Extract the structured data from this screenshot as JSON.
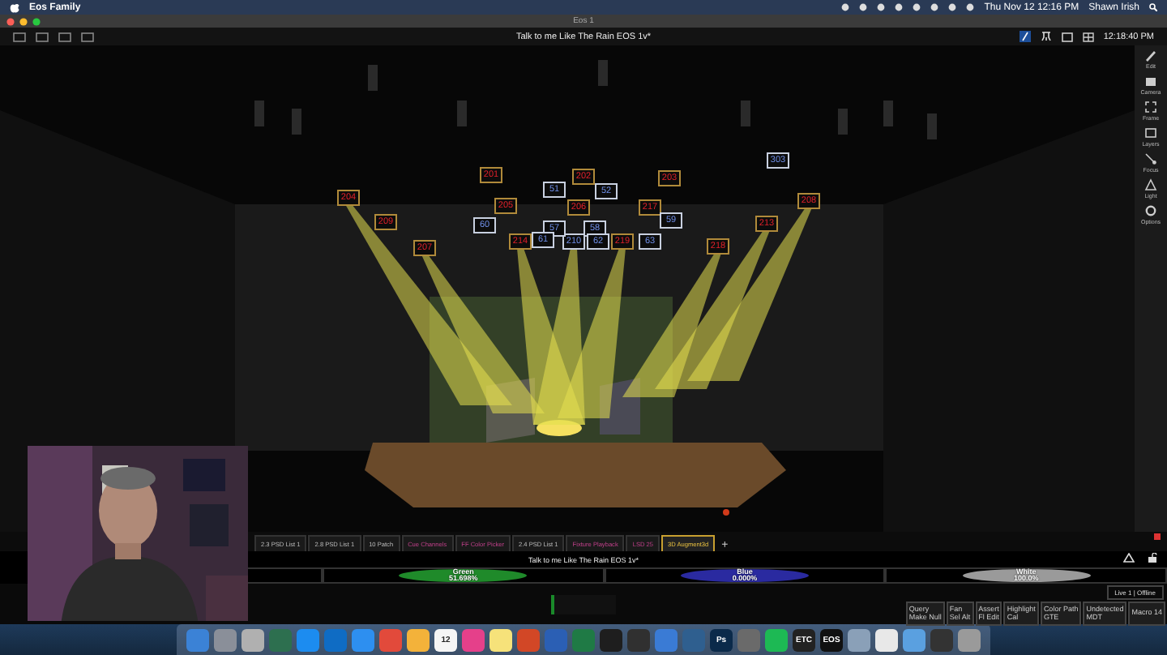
{
  "menu_bar": {
    "app": "Eos Family",
    "clock": "Thu Nov 12 12:16 PM",
    "user": "Shawn Irish"
  },
  "window": {
    "title": "Eos 1"
  },
  "toolbar": {
    "title": "Talk to me Like The Rain EOS 1v*",
    "clock": "12:18:40 PM"
  },
  "fixtures": [
    {
      "label": "204",
      "kind": "conventional"
    },
    {
      "label": "209",
      "kind": "conventional"
    },
    {
      "label": "207",
      "kind": "conventional"
    },
    {
      "label": "201",
      "kind": "conventional"
    },
    {
      "label": "205",
      "kind": "conventional"
    },
    {
      "label": "214",
      "kind": "conventional"
    },
    {
      "label": "202",
      "kind": "conventional"
    },
    {
      "label": "206",
      "kind": "conventional"
    },
    {
      "label": "210",
      "kind": "led"
    },
    {
      "label": "219",
      "kind": "conventional"
    },
    {
      "label": "203",
      "kind": "conventional"
    },
    {
      "label": "217",
      "kind": "conventional"
    },
    {
      "label": "213",
      "kind": "conventional"
    },
    {
      "label": "208",
      "kind": "conventional"
    },
    {
      "label": "218",
      "kind": "conventional"
    },
    {
      "label": "303",
      "kind": "led"
    },
    {
      "label": "51",
      "kind": "led"
    },
    {
      "label": "52",
      "kind": "led"
    },
    {
      "label": "60",
      "kind": "led"
    },
    {
      "label": "57",
      "kind": "led"
    },
    {
      "label": "58",
      "kind": "led"
    },
    {
      "label": "59",
      "kind": "led"
    },
    {
      "label": "61",
      "kind": "led"
    },
    {
      "label": "62",
      "kind": "led"
    },
    {
      "label": "63",
      "kind": "led"
    }
  ],
  "side_tools": [
    "Edit",
    "Camera",
    "Frame",
    "Layers",
    "Focus",
    "Light",
    "Options"
  ],
  "tabs": [
    {
      "label": "2.3 PSD List 1",
      "selected": false,
      "kind": "plain"
    },
    {
      "label": "2.8 PSD List 1",
      "selected": false,
      "kind": "plain"
    },
    {
      "label": "10 Patch",
      "selected": false,
      "kind": "plain"
    },
    {
      "label": "Cue Channels",
      "selected": false,
      "kind": "pink"
    },
    {
      "label": "FF Color Picker",
      "selected": false,
      "kind": "pink"
    },
    {
      "label": "2.4 PSD List 1",
      "selected": false,
      "kind": "plain"
    },
    {
      "label": "Fixture Playback",
      "selected": false,
      "kind": "pink"
    },
    {
      "label": "LSD 25",
      "selected": false,
      "kind": "pink"
    },
    {
      "label": "3D Augment3d",
      "selected": true,
      "kind": "plain"
    }
  ],
  "add_tab": "+",
  "cue_line": {
    "title": "Talk to me Like The Rain EOS 1v*"
  },
  "color_bars": [
    {
      "name": "Green",
      "reading": "51.698%",
      "color": "#1f8a2a"
    },
    {
      "name": "Blue",
      "reading": "0.000%",
      "color": "#2a2aa0"
    },
    {
      "name": "White",
      "reading": "100.0%",
      "color": "#9a9a9a"
    }
  ],
  "status": "Live 1 | Offline",
  "softkeys": [
    {
      "label": "Query",
      "value": "Make Null"
    },
    {
      "label": "Fan",
      "value": "Sel Alt"
    },
    {
      "label": "Assert",
      "value": "Fl Edit"
    },
    {
      "label": "Highlight",
      "value": "Cal"
    },
    {
      "label": "Color Path",
      "value": "GTE"
    },
    {
      "label": "Undetected",
      "value": "MDT"
    },
    {
      "value": "Macro 14"
    }
  ],
  "dock": [
    {
      "color": "#3b82d6"
    },
    {
      "color": "#8a8f99"
    },
    {
      "color": "#b0b0b0"
    },
    {
      "color": "#2d6f4f"
    },
    {
      "color": "#1c8cf0"
    },
    {
      "color": "#0f6cc4"
    },
    {
      "color": "#2d8ff0"
    },
    {
      "color": "#e24a3b"
    },
    {
      "color": "#f3b23a"
    },
    {
      "color": "#f5f5f5",
      "label": "12"
    },
    {
      "color": "#e5408a"
    },
    {
      "color": "#f6e27a"
    },
    {
      "color": "#d24726"
    },
    {
      "color": "#2b5fb4"
    },
    {
      "color": "#1f7a45"
    },
    {
      "color": "#1e1e1e"
    },
    {
      "color": "#303030"
    },
    {
      "color": "#3a7bd5"
    },
    {
      "color": "#2f5f8f"
    },
    {
      "color": "#0b2a4a",
      "label": "Ps"
    },
    {
      "color": "#6a6a6a"
    },
    {
      "color": "#1db954"
    },
    {
      "color": "#222222",
      "label": "ETC"
    },
    {
      "color": "#111111",
      "label": "EOS"
    },
    {
      "color": "#8aa0b8"
    },
    {
      "color": "#e8e8e8"
    },
    {
      "color": "#5aa0e0"
    },
    {
      "color": "#333333"
    },
    {
      "color": "#9a9a9a"
    }
  ]
}
